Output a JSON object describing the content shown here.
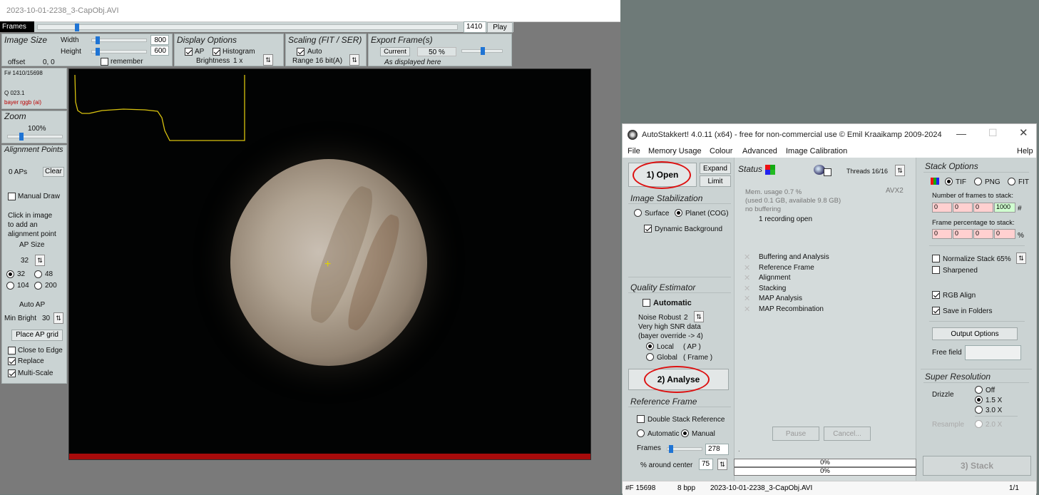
{
  "viewer": {
    "title": "2023-10-01-2238_3-CapObj.AVI",
    "frames_label": "Frames",
    "frame_value": "1410",
    "play_label": "Play",
    "image_size": {
      "title": "Image Size",
      "width_label": "Width",
      "height_label": "Height",
      "width": "800",
      "height": "600",
      "remember_label": "remember",
      "offset_label": "offset",
      "offset_value": "0, 0"
    },
    "display_options": {
      "title": "Display Options",
      "ap_label": "AP",
      "histogram_label": "Histogram",
      "brightness_label": "Brightness",
      "brightness_value": "1 x"
    },
    "scaling": {
      "title": "Scaling (FIT / SER)",
      "auto_label": "Auto",
      "range_label": "Range 16 bit(A)"
    },
    "export": {
      "title": "Export Frame(s)",
      "current_label": "Current",
      "percent": "50 %",
      "note": "As displayed here"
    },
    "info": {
      "frame": "F# 1410/15698",
      "quality": "Q  023.1",
      "bayer": "bayer rggb (ai)"
    },
    "zoom": {
      "title": "Zoom",
      "value": "100%"
    },
    "alignment": {
      "title": "Alignment Points",
      "count": "0 APs",
      "clear_label": "Clear",
      "manual_draw_label": "Manual Draw",
      "hint": [
        "Click in image",
        "to add an",
        "alignment point"
      ],
      "ap_size_label": "AP Size",
      "ap_size_value": "32",
      "sizes": [
        "32",
        "48",
        "104",
        "200"
      ],
      "auto_ap_label": "Auto AP",
      "min_bright_label": "Min Bright",
      "min_bright_value": "30",
      "place_grid_label": "Place AP grid",
      "close_edge_label": "Close to Edge",
      "replace_label": "Replace",
      "multiscale_label": "Multi-Scale"
    }
  },
  "autostakkert": {
    "title": "AutoStakkert! 4.0.11 (x64) - free for non-commercial use © Emil Kraaikamp 2009-2024",
    "menu": [
      "File",
      "Memory Usage",
      "Colour",
      "Advanced",
      "Image Calibration",
      "Help"
    ],
    "open_label": "1) Open",
    "expand_label": "Expand",
    "limit_label": "Limit",
    "image_stabilization": {
      "title": "Image Stabilization",
      "surface_label": "Surface",
      "planet_label": "Planet (COG)",
      "dynamic_bg_label": "Dynamic Background"
    },
    "quality": {
      "title": "Quality Estimator",
      "automatic_label": "Automatic",
      "noise_label": "Noise Robust",
      "noise_value": "2",
      "snr_line1": "Very high SNR data",
      "snr_line2": "(bayer override -> 4)",
      "local_label": "Local",
      "local_sub": "( AP )",
      "global_label": "Global",
      "global_sub": "( Frame )"
    },
    "analyse_label": "2) Analyse",
    "reference": {
      "title": "Reference Frame",
      "double_stack_label": "Double Stack Reference",
      "automatic_label": "Automatic",
      "manual_label": "Manual",
      "frames_label": "Frames",
      "frames_value": "278",
      "around_label": "% around center",
      "around_value": "75"
    },
    "status": {
      "title": "Status",
      "threads_label": "Threads 16/16",
      "avx": "AVX2",
      "mem1": "Mem. usage 0.7 %",
      "mem2": "(used 0.1 GB, available 9.8 GB)",
      "mem3": "no buffering",
      "recording": "1 recording open",
      "steps": [
        "Buffering and Analysis",
        "Reference Frame",
        "Alignment",
        "Stacking",
        "MAP Analysis",
        "MAP Recombination"
      ],
      "pause_label": "Pause",
      "cancel_label": "Cancel...",
      "dot": ".",
      "progress1": "0%",
      "progress2": "0%"
    },
    "stack_options": {
      "title": "Stack Options",
      "tif_label": "TIF",
      "png_label": "PNG",
      "fit_label": "FIT",
      "num_frames_label": "Number of frames to stack:",
      "num_frames": [
        "0",
        "0",
        "0",
        "1000"
      ],
      "hash": "#",
      "pct_label": "Frame percentage to stack:",
      "pct_values": [
        "0",
        "0",
        "0",
        "0"
      ],
      "pct": "%",
      "normalize_label": "Normalize Stack 65%",
      "sharpened_label": "Sharpened",
      "rgb_align_label": "RGB Align",
      "save_folders_label": "Save in Folders",
      "output_options_label": "Output Options",
      "free_field_label": "Free field"
    },
    "super_res": {
      "title": "Super Resolution",
      "drizzle_label": "Drizzle",
      "off_label": "Off",
      "x15_label": "1.5 X",
      "x30_label": "3.0 X",
      "resample_label": "Resample",
      "x20_label": "2.0 X"
    },
    "stack_label": "3) Stack",
    "statusbar": {
      "frames": "#F 15698",
      "bpp": "8 bpp",
      "file": "2023-10-01-2238_3-CapObj.AVI",
      "page": "1/1"
    }
  }
}
